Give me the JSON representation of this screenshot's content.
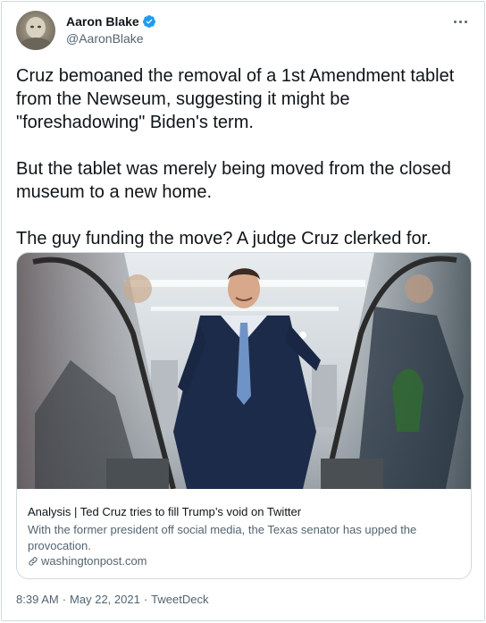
{
  "author": {
    "display_name": "Aaron Blake",
    "handle": "@AaronBlake",
    "verified": true,
    "avatar_icon": "avatar-photo"
  },
  "more_icon": "more-horizontal-icon",
  "tweet": {
    "text": "Cruz bemoaned the removal of a 1st Amendment tablet from the Newseum, suggesting it might be \"foreshadowing\" Biden's term.\n\nBut the tablet was merely being moved from the closed museum to a new home.\n\nThe guy funding the move? A judge Cruz clerked for."
  },
  "card": {
    "image_icon": "senator-escalator-photo",
    "title": "Analysis | Ted Cruz tries to fill Trump’s void on Twitter",
    "description": "With the former president off social media, the Texas senator has upped the provocation.",
    "domain": "washingtonpost.com",
    "link_icon": "link-icon"
  },
  "meta": {
    "time": "8:39 AM",
    "separator": "·",
    "date": "May 22, 2021",
    "source": "TweetDeck"
  },
  "colors": {
    "primary_text": "#0f1419",
    "secondary_text": "#536471",
    "border": "#cfd9de",
    "verified_badge": "#1d9bf0"
  }
}
